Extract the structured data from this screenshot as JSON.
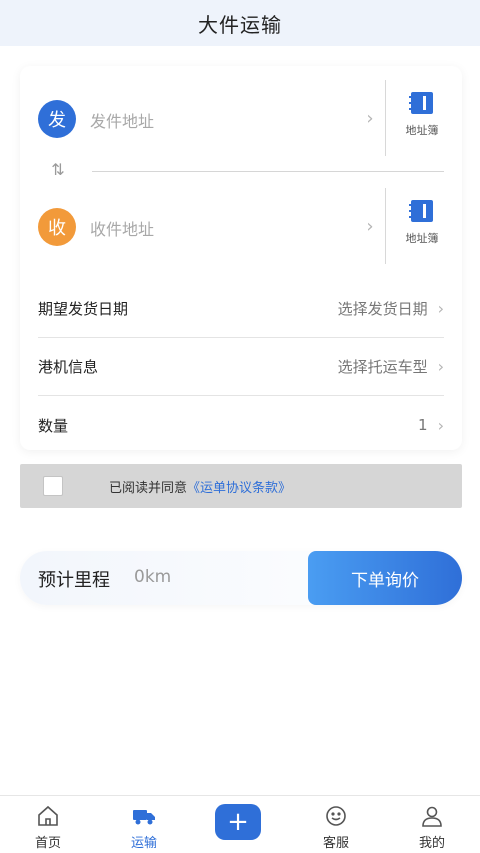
{
  "header": {
    "title": "大件运输"
  },
  "sender": {
    "badge": "发",
    "placeholder": "发件地址",
    "book_label": "地址簿"
  },
  "receiver": {
    "badge": "收",
    "placeholder": "收件地址",
    "book_label": "地址簿"
  },
  "form": {
    "date": {
      "label": "期望发货日期",
      "value": "选择发货日期"
    },
    "machine": {
      "label": "港机信息",
      "value": "选择托运车型"
    },
    "quantity": {
      "label": "数量",
      "value": "1"
    }
  },
  "agreement": {
    "text": "已阅读并同意",
    "link": "《运单协议条款》"
  },
  "estimate": {
    "label": "预计里程",
    "value": "0km",
    "button": "下单询价"
  },
  "tabbar": {
    "items": [
      {
        "label": "首页",
        "icon": "home-icon"
      },
      {
        "label": "运输",
        "icon": "truck-icon"
      },
      {
        "label": "",
        "icon": "plus-icon"
      },
      {
        "label": "客服",
        "icon": "customer-service-icon"
      },
      {
        "label": "我的",
        "icon": "user-icon"
      }
    ],
    "active_index": 1
  },
  "colors": {
    "primary": "#2f6fd8",
    "orange": "#f29a3a"
  }
}
